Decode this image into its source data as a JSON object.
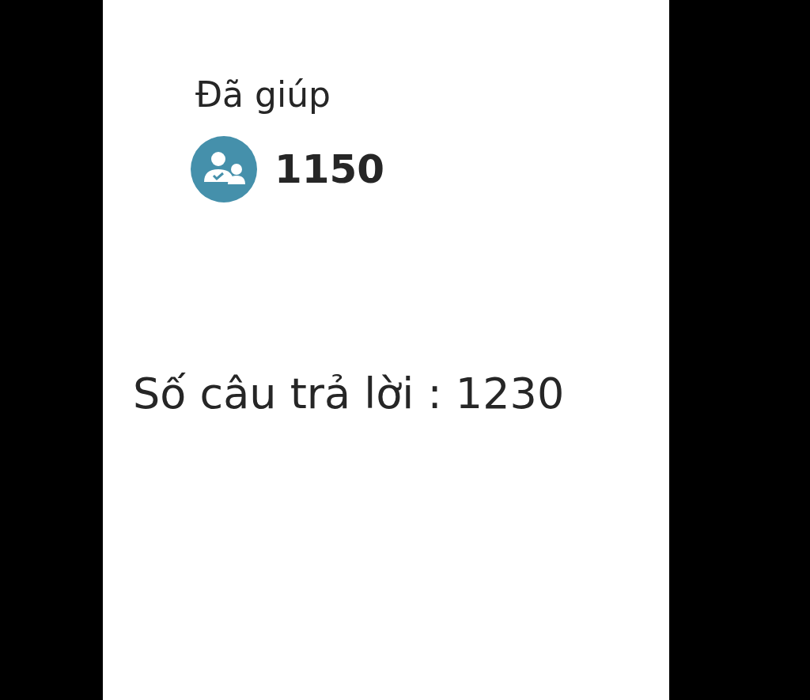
{
  "helped": {
    "label": "Đã giúp",
    "count": "1150"
  },
  "answers": {
    "text": "Số câu trả lời : 1230"
  }
}
